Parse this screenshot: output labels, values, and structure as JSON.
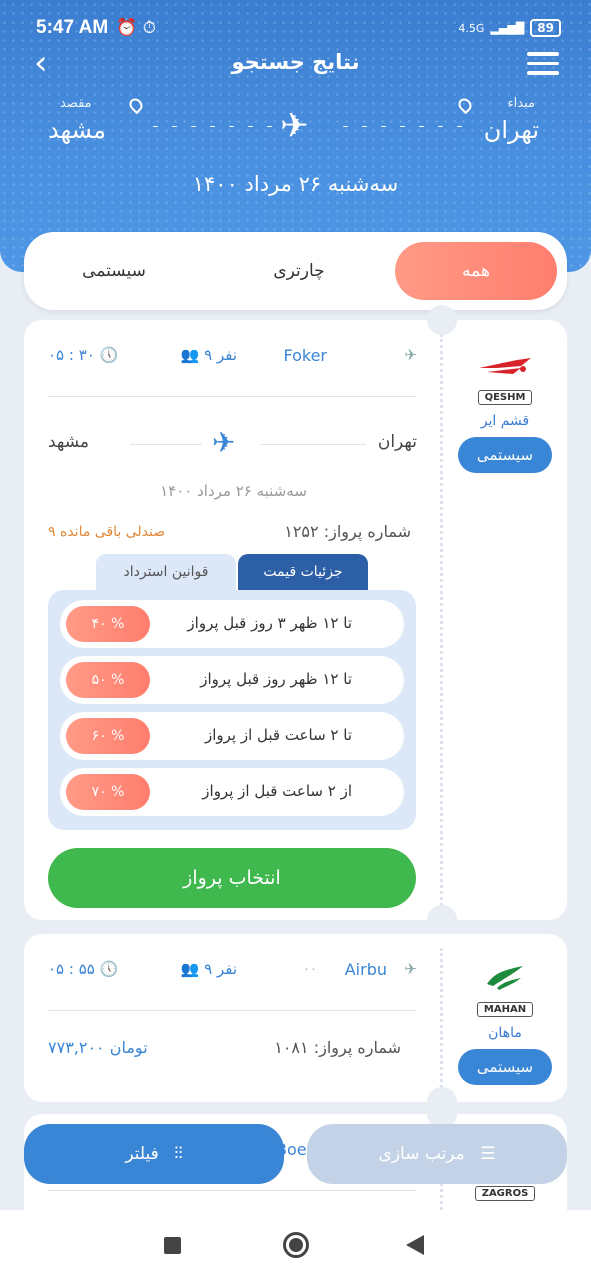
{
  "status": {
    "time": "5:47 AM",
    "network": "4.5G",
    "battery": "89"
  },
  "header": {
    "title": "نتایج جستجو",
    "origin_label": "مبداء",
    "origin_city": "تهران",
    "dest_label": "مقصد",
    "dest_city": "مشهد",
    "date": "سه‌شنبه ۲۶ مرداد ۱۴۰۰"
  },
  "tabs": {
    "all": "همه",
    "charter": "چارتری",
    "system": "سیستمی"
  },
  "flight1": {
    "airline_badge": "QESHM",
    "airline_name": "قشم ایر",
    "type": "سیستمی",
    "aircraft": "Foker",
    "seats": "۹ نفر",
    "time": "۰۵ : ۳۰",
    "origin": "تهران",
    "dest": "مشهد",
    "date": "سه‌شنبه ۲۶ مرداد ۱۴۰۰",
    "flight_no": "شماره پرواز: ۱۲۵۲",
    "remaining": "۹ صندلی باقی مانده",
    "tab_price": "جزئیات قیمت",
    "tab_refund": "قوانین استرداد",
    "rules": [
      {
        "text": "تا ۱۲ ظهر ۳ روز قبل پرواز",
        "pct": "۴۰ %"
      },
      {
        "text": "تا ۱۲ ظهر روز قبل پرواز",
        "pct": "۵۰ %"
      },
      {
        "text": "تا ۲ ساعت قبل از پرواز",
        "pct": "۶۰ %"
      },
      {
        "text": "از ۲ ساعت قبل از پرواز",
        "pct": "۷۰ %"
      }
    ],
    "select": "انتخاب پرواز"
  },
  "flight2": {
    "airline_badge": "MAHAN",
    "airline_name": "ماهان",
    "type": "سیستمی",
    "aircraft": "Airbu",
    "aircraft_extra": "۰۰",
    "seats": "۹ نفر",
    "time": "۰۵ : ۵۵",
    "flight_no": "شماره پرواز: ۱۰۸۱",
    "price": "۷۷۳,۲۰۰ تومان"
  },
  "flight3": {
    "airline_badge": "ZAGROS",
    "aircraft": "Boe"
  },
  "bottom": {
    "filter": "فیلتر",
    "sort": "مرتب سازی"
  },
  "colors": {
    "primary": "#3a86d6",
    "accent": "#ff8a78",
    "green": "#3fb84d"
  }
}
